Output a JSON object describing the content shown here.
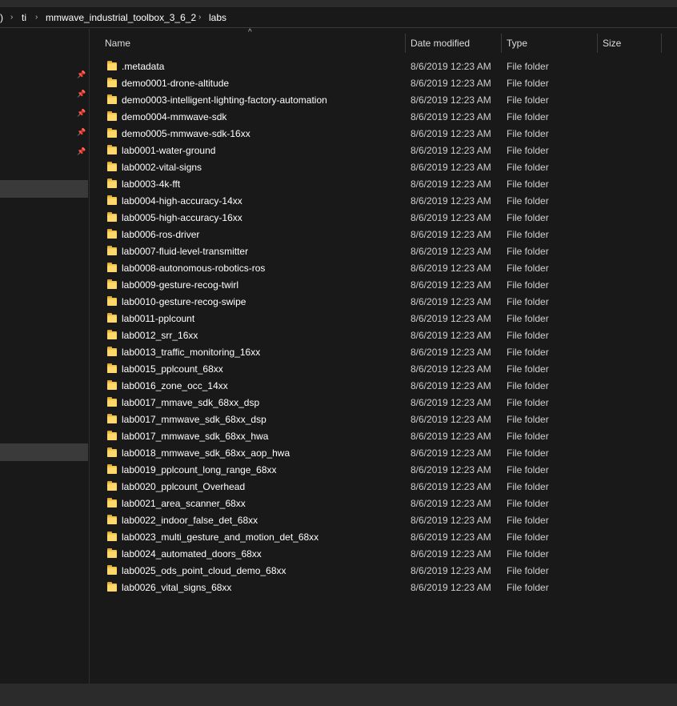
{
  "breadcrumb": {
    "parts": [
      ")",
      "ti",
      "mmwave_industrial_toolbox_3_6_2",
      "labs"
    ]
  },
  "columns": {
    "name": "Name",
    "date_modified": "Date modified",
    "type": "Type",
    "size": "Size"
  },
  "files": [
    {
      "name": ".metadata",
      "date": "8/6/2019 12:23 AM",
      "type": "File folder",
      "size": ""
    },
    {
      "name": "demo0001-drone-altitude",
      "date": "8/6/2019 12:23 AM",
      "type": "File folder",
      "size": ""
    },
    {
      "name": "demo0003-intelligent-lighting-factory-automation",
      "date": "8/6/2019 12:23 AM",
      "type": "File folder",
      "size": ""
    },
    {
      "name": "demo0004-mmwave-sdk",
      "date": "8/6/2019 12:23 AM",
      "type": "File folder",
      "size": ""
    },
    {
      "name": "demo0005-mmwave-sdk-16xx",
      "date": "8/6/2019 12:23 AM",
      "type": "File folder",
      "size": ""
    },
    {
      "name": "lab0001-water-ground",
      "date": "8/6/2019 12:23 AM",
      "type": "File folder",
      "size": ""
    },
    {
      "name": "lab0002-vital-signs",
      "date": "8/6/2019 12:23 AM",
      "type": "File folder",
      "size": ""
    },
    {
      "name": "lab0003-4k-fft",
      "date": "8/6/2019 12:23 AM",
      "type": "File folder",
      "size": ""
    },
    {
      "name": "lab0004-high-accuracy-14xx",
      "date": "8/6/2019 12:23 AM",
      "type": "File folder",
      "size": ""
    },
    {
      "name": "lab0005-high-accuracy-16xx",
      "date": "8/6/2019 12:23 AM",
      "type": "File folder",
      "size": ""
    },
    {
      "name": "lab0006-ros-driver",
      "date": "8/6/2019 12:23 AM",
      "type": "File folder",
      "size": ""
    },
    {
      "name": "lab0007-fluid-level-transmitter",
      "date": "8/6/2019 12:23 AM",
      "type": "File folder",
      "size": ""
    },
    {
      "name": "lab0008-autonomous-robotics-ros",
      "date": "8/6/2019 12:23 AM",
      "type": "File folder",
      "size": ""
    },
    {
      "name": "lab0009-gesture-recog-twirl",
      "date": "8/6/2019 12:23 AM",
      "type": "File folder",
      "size": ""
    },
    {
      "name": "lab0010-gesture-recog-swipe",
      "date": "8/6/2019 12:23 AM",
      "type": "File folder",
      "size": ""
    },
    {
      "name": "lab0011-pplcount",
      "date": "8/6/2019 12:23 AM",
      "type": "File folder",
      "size": ""
    },
    {
      "name": "lab0012_srr_16xx",
      "date": "8/6/2019 12:23 AM",
      "type": "File folder",
      "size": ""
    },
    {
      "name": "lab0013_traffic_monitoring_16xx",
      "date": "8/6/2019 12:23 AM",
      "type": "File folder",
      "size": ""
    },
    {
      "name": "lab0015_pplcount_68xx",
      "date": "8/6/2019 12:23 AM",
      "type": "File folder",
      "size": ""
    },
    {
      "name": "lab0016_zone_occ_14xx",
      "date": "8/6/2019 12:23 AM",
      "type": "File folder",
      "size": ""
    },
    {
      "name": "lab0017_mmave_sdk_68xx_dsp",
      "date": "8/6/2019 12:23 AM",
      "type": "File folder",
      "size": ""
    },
    {
      "name": "lab0017_mmwave_sdk_68xx_dsp",
      "date": "8/6/2019 12:23 AM",
      "type": "File folder",
      "size": ""
    },
    {
      "name": "lab0017_mmwave_sdk_68xx_hwa",
      "date": "8/6/2019 12:23 AM",
      "type": "File folder",
      "size": ""
    },
    {
      "name": "lab0018_mmwave_sdk_68xx_aop_hwa",
      "date": "8/6/2019 12:23 AM",
      "type": "File folder",
      "size": ""
    },
    {
      "name": "lab0019_pplcount_long_range_68xx",
      "date": "8/6/2019 12:23 AM",
      "type": "File folder",
      "size": ""
    },
    {
      "name": "lab0020_pplcount_Overhead",
      "date": "8/6/2019 12:23 AM",
      "type": "File folder",
      "size": ""
    },
    {
      "name": "lab0021_area_scanner_68xx",
      "date": "8/6/2019 12:23 AM",
      "type": "File folder",
      "size": ""
    },
    {
      "name": "lab0022_indoor_false_det_68xx",
      "date": "8/6/2019 12:23 AM",
      "type": "File folder",
      "size": ""
    },
    {
      "name": "lab0023_multi_gesture_and_motion_det_68xx",
      "date": "8/6/2019 12:23 AM",
      "type": "File folder",
      "size": ""
    },
    {
      "name": "lab0024_automated_doors_68xx",
      "date": "8/6/2019 12:23 AM",
      "type": "File folder",
      "size": ""
    },
    {
      "name": "lab0025_ods_point_cloud_demo_68xx",
      "date": "8/6/2019 12:23 AM",
      "type": "File folder",
      "size": ""
    },
    {
      "name": "lab0026_vital_signs_68xx",
      "date": "8/6/2019 12:23 AM",
      "type": "File folder",
      "size": ""
    }
  ],
  "colors": {
    "background": "#191919",
    "header_text": "#dcdcdc",
    "folder_yellow": "#f2c64c",
    "selection": "#3a3a3a"
  }
}
